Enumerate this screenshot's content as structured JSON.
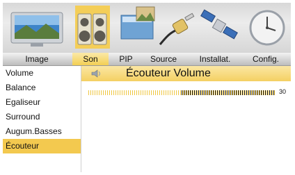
{
  "tabs": [
    {
      "label": "Image",
      "active": false
    },
    {
      "label": "Son",
      "active": true
    },
    {
      "label": "PIP",
      "active": false
    },
    {
      "label": "Source",
      "active": false
    },
    {
      "label": "Installat.",
      "active": false
    },
    {
      "label": "Config.",
      "active": false
    }
  ],
  "icons": [
    "tv-icon",
    "speaker-icon",
    "pip-icon",
    "plug-icon",
    "satellite-icon",
    "clock-icon"
  ],
  "menu": {
    "items": [
      {
        "label": "Volume"
      },
      {
        "label": "Balance"
      },
      {
        "label": "Egaliseur"
      },
      {
        "label": "Surround"
      },
      {
        "label": "Augum.Basses"
      },
      {
        "label": "Écouteur",
        "selected": true
      }
    ]
  },
  "panel": {
    "title": "Écouteur Volume",
    "icon": "speaker-icon",
    "slider": {
      "value": "30",
      "fraction": 0.5
    }
  },
  "colors": {
    "accent": "#f3c94f",
    "slider_track": "#efc640",
    "slider_fill": "#1a1a1a"
  }
}
